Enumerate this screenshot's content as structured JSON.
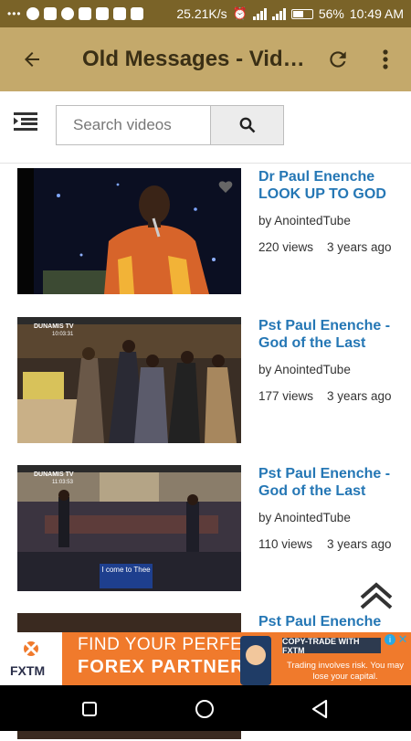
{
  "status_bar": {
    "speed": "25.21K/s",
    "battery": "56%",
    "time": "10:49 AM",
    "battery_level": 0.56
  },
  "app_bar": {
    "title": "Old Messages - Vid…",
    "back_icon": "arrow-left-icon",
    "refresh_icon": "refresh-icon",
    "more_icon": "more-vertical-icon"
  },
  "search": {
    "placeholder": "Search videos",
    "value": "",
    "menu_icon": "list-menu-icon",
    "button_icon": "search-icon"
  },
  "videos": [
    {
      "title": "Dr Paul Enenche LOOK UP TO GOD",
      "channel": "by AnointedTube",
      "views": "220 views",
      "age": "3 years ago"
    },
    {
      "title": "Pst Paul Enenche - God of the Last",
      "channel": "by AnointedTube",
      "views": "177 views",
      "age": "3 years ago"
    },
    {
      "title": "Pst Paul Enenche - God of the Last",
      "channel": "by AnointedTube",
      "views": "110 views",
      "age": "3 years ago"
    },
    {
      "title": "Pst Paul Enenche",
      "channel": "",
      "views": "",
      "age": ""
    }
  ],
  "thumbnail_overlays": {
    "video2_logo": "DUNAMIS TV",
    "video2_time": "10:03:31",
    "video3_logo": "DUNAMIS TV",
    "video3_time": "11:03:53",
    "video3_caption": "I come to Thee"
  },
  "ad": {
    "brand": "FXTM",
    "line1": "FIND YOUR PERFECT",
    "line2": "FOREX PARTNER",
    "cta": "COPY-TRADE WITH FXTM",
    "risk": "Trading involves risk. You may lose your capital.",
    "accent": "#f07a2c"
  },
  "colors": {
    "status_bar": "#7a6328",
    "app_bar": "#c4a96b",
    "link_title": "#2577b5"
  }
}
